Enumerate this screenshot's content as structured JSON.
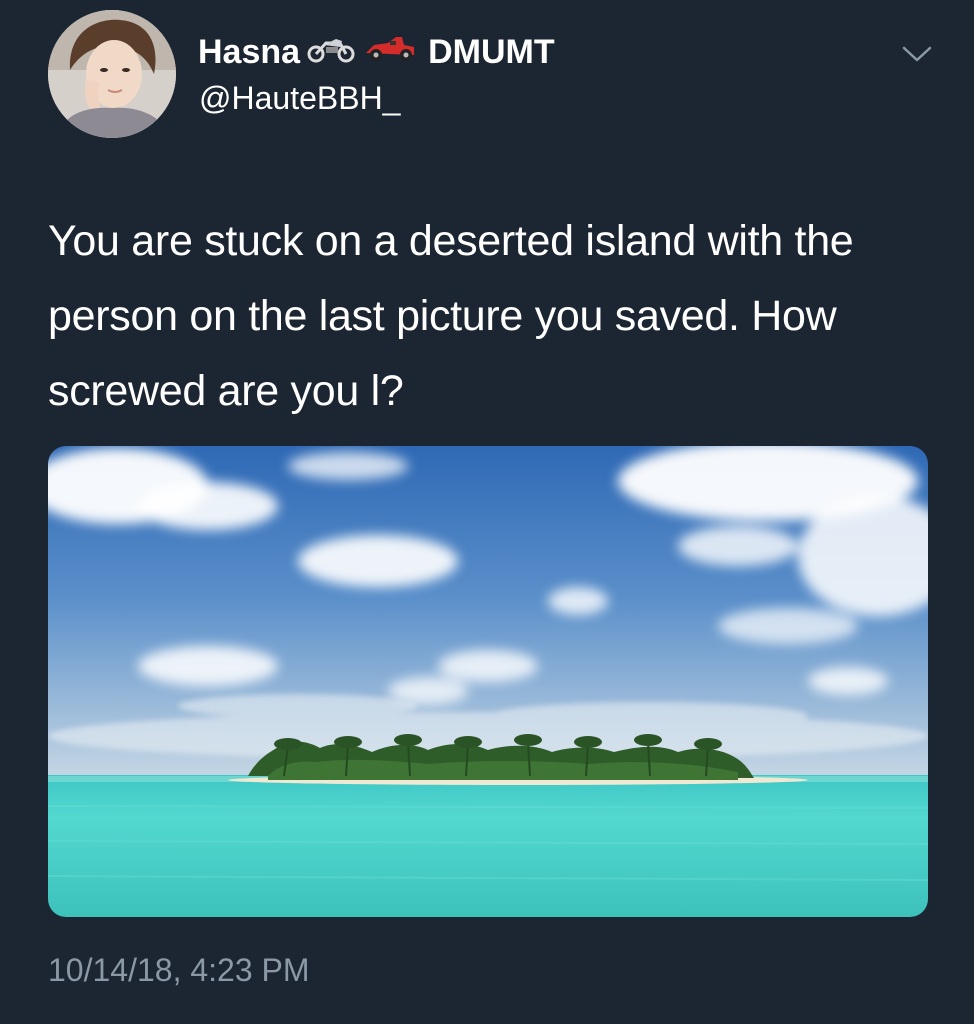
{
  "tweet": {
    "display_name": "Hasna",
    "emoji_1": "motorcycle-emoji",
    "emoji_2": "race-car-emoji",
    "display_name_suffix": "DMUMT",
    "handle": "@HauteBBH_",
    "text": "You are stuck on a deserted island with the person on the last picture you saved. How screwed are you l?",
    "timestamp": "10/14/18, 4:23 PM",
    "menu_icon": "chevron-down-icon"
  },
  "colors": {
    "background": "#1c2532",
    "text": "#ffffff",
    "muted_text": "#8b98a5"
  }
}
